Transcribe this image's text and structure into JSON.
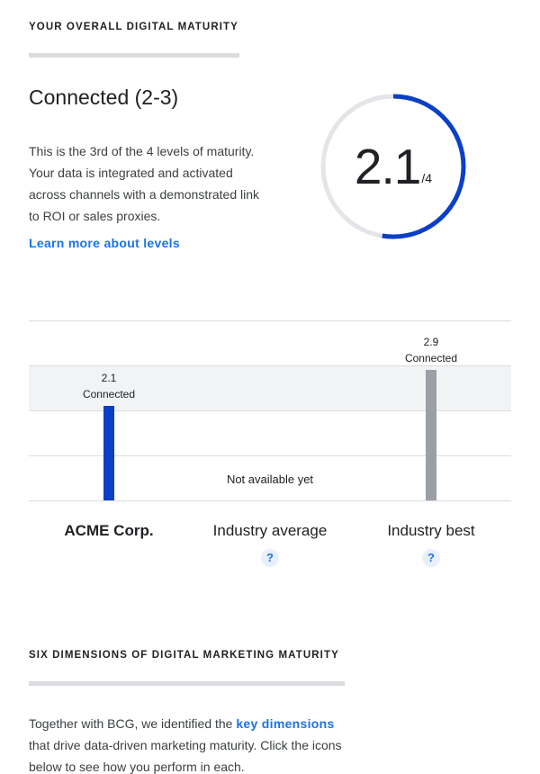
{
  "overall": {
    "section_title": "YOUR OVERALL DIGITAL MATURITY",
    "level_heading": "Connected (2-3)",
    "description": "This is the 3rd of the 4 levels of maturity. Your data is integrated and activated across channels with a demonstrated link to ROI or sales proxies.",
    "learn_more_link": "Learn more about levels",
    "score": "2.1",
    "score_max": "/4",
    "score_fraction": 0.525,
    "colors": {
      "accent": "#0b3fc6",
      "track": "#e3e5e8",
      "link": "#1a73e8",
      "industry_bar": "#9aa0a6"
    }
  },
  "comparison": {
    "columns": [
      {
        "name": "ACME Corp.",
        "value_label": "2.1",
        "level_label": "Connected",
        "value": 2.1
      },
      {
        "name": "Industry average",
        "not_available": "Not available yet"
      },
      {
        "name": "Industry best",
        "value_label": "2.9",
        "level_label": "Connected",
        "value": 2.9
      }
    ],
    "help_icon": "?"
  },
  "dimensions": {
    "section_title": "SIX DIMENSIONS OF DIGITAL MARKETING MATURITY",
    "intro_before": "Together with BCG, we identified the ",
    "intro_link": "key dimensions",
    "intro_after": " that drive data-driven marketing maturity. Click the icons below to see how you perform in each."
  }
}
